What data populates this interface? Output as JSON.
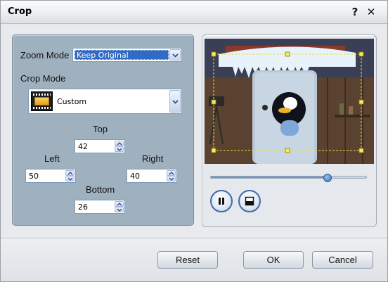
{
  "window": {
    "title": "Crop",
    "help_glyph": "?",
    "close_glyph": "✕"
  },
  "settings": {
    "zoom_mode_label": "Zoom Mode",
    "zoom_mode_value": "Keep Original",
    "crop_mode_label": "Crop Mode",
    "crop_mode_value": "Custom",
    "crop_mode_icon": "film-strip-icon",
    "top": {
      "label": "Top",
      "value": "42"
    },
    "left": {
      "label": "Left",
      "value": "50"
    },
    "right": {
      "label": "Right",
      "value": "40"
    },
    "bottom": {
      "label": "Bottom",
      "value": "26"
    }
  },
  "preview": {
    "seek_position": 0.75,
    "controls": [
      "pause-icon",
      "stop-icon"
    ],
    "crop_frame_color": "#e8e040"
  },
  "footer": {
    "reset_label": "Reset",
    "ok_label": "OK",
    "cancel_label": "Cancel"
  },
  "colors": {
    "accent": "#316ac5",
    "settings_panel": "#9fb0bf",
    "button_ring": "#3e6aa6"
  }
}
